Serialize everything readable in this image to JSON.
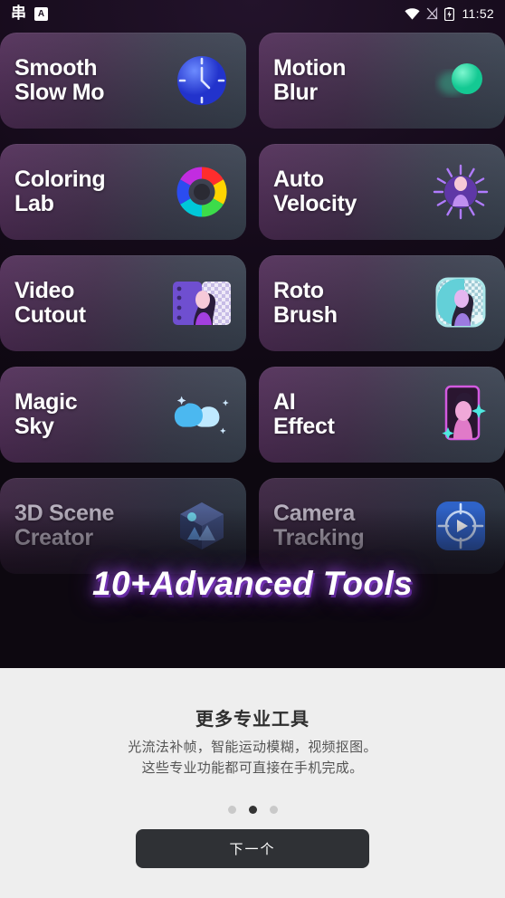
{
  "statusbar": {
    "left_glyph": "串",
    "left_badge": "A",
    "icons": [
      "wifi-icon",
      "signal-off-icon",
      "battery-charging-icon"
    ],
    "time": "11:52"
  },
  "hero": {
    "headline": "10+Advanced Tools",
    "background_color": "#0d0810",
    "accent_color": "#a855f7",
    "cards": [
      {
        "label": "Smooth\nSlow Mo",
        "icon": "clock-icon",
        "icon_color": "#3b5bf5",
        "faded": false
      },
      {
        "label": "Motion\nBlur",
        "icon": "blur-sphere-icon",
        "icon_color": "#2fe3a8",
        "faded": false
      },
      {
        "label": "Coloring\nLab",
        "icon": "color-wheel-icon",
        "icon_color": "#ff2d55",
        "faded": false
      },
      {
        "label": "Auto\nVelocity",
        "icon": "speed-burst-icon",
        "icon_color": "#9b59ff",
        "faded": false
      },
      {
        "label": "Video\nCutout",
        "icon": "cutout-icon",
        "icon_color": "#8b6ae0",
        "faded": false
      },
      {
        "label": "Roto\nBrush",
        "icon": "roto-brush-icon",
        "icon_color": "#4fd6d6",
        "faded": false
      },
      {
        "label": "Magic\nSky",
        "icon": "cloud-sparkle-icon",
        "icon_color": "#49c6f5",
        "faded": false
      },
      {
        "label": "AI\nEffect",
        "icon": "ai-portrait-icon",
        "icon_color": "#e05ad0",
        "faded": false
      },
      {
        "label": "3D Scene\nCreator",
        "icon": "cube-scene-icon",
        "icon_color": "#5a7fd0",
        "faded": true
      },
      {
        "label": "Camera\nTracking",
        "icon": "tracking-icon",
        "icon_color": "#3d7ae0",
        "faded": true
      }
    ]
  },
  "sheet": {
    "title": "更多专业工具",
    "body": "光流法补帧，智能运动模糊，视频抠图。\n这些专业功能都可直接在手机完成。",
    "pagination": {
      "count": 3,
      "active_index": 1
    },
    "next_label": "下一个"
  }
}
